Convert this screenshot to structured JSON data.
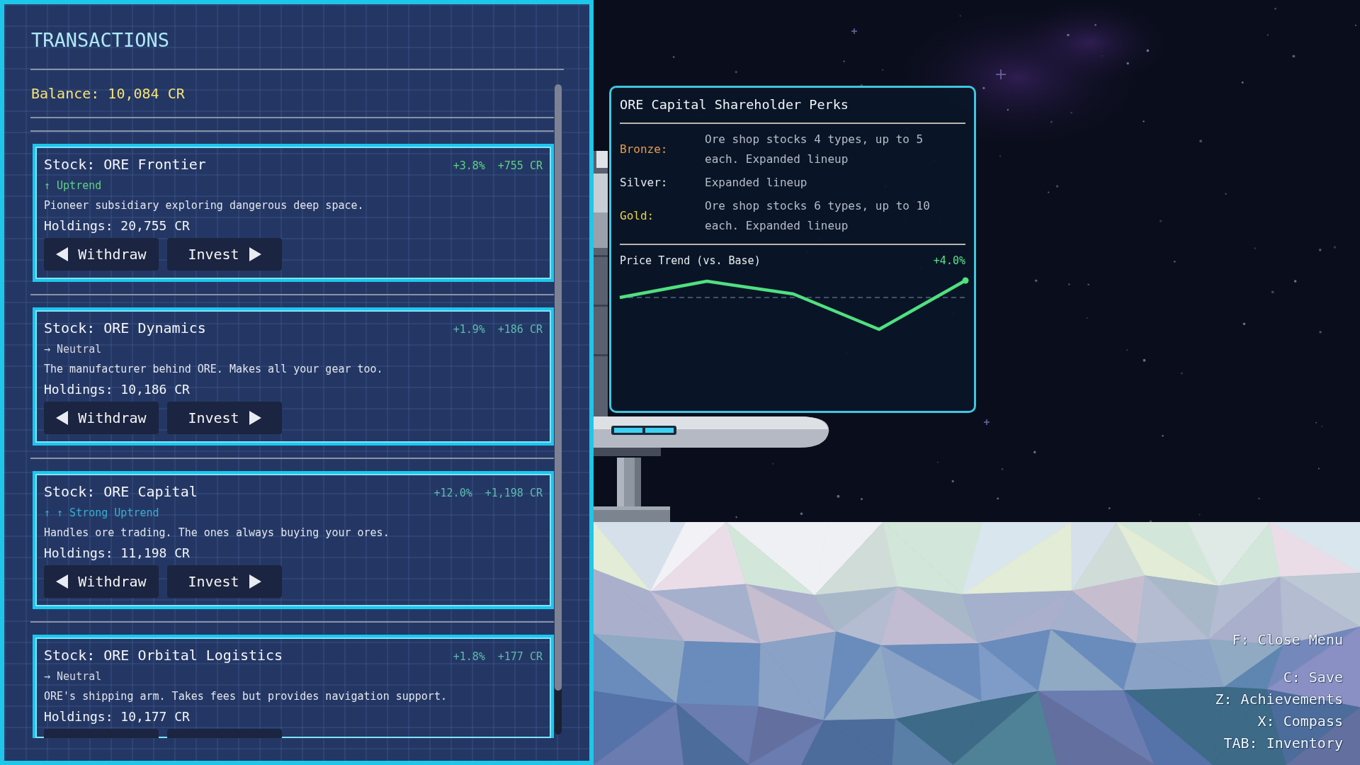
{
  "panel": {
    "title": "TRANSACTIONS",
    "balance": "Balance: 10,084 CR"
  },
  "stocks": [
    {
      "name": "Stock: ORE Frontier",
      "change": {
        "percent": "+3.8%",
        "amount": "+755 CR",
        "color": "#5cd483"
      },
      "trend": {
        "text": "↑ Uptrend",
        "color": "#5cd483"
      },
      "description": "Pioneer subsidiary exploring dangerous deep space.",
      "holdings": "Holdings: 20,755 CR",
      "buttons": [
        {
          "kind": "withdraw",
          "label": "Withdraw"
        },
        {
          "kind": "invest",
          "label": "Invest"
        }
      ]
    },
    {
      "name": "Stock: ORE Dynamics",
      "change": {
        "percent": "+1.9%",
        "amount": "+186 CR",
        "color": "#5cbcb0"
      },
      "trend": {
        "text": "→ Neutral",
        "color": "#d4d8e0"
      },
      "description": "The manufacturer behind ORE. Makes all your gear too.",
      "holdings": "Holdings: 10,186 CR",
      "buttons": [
        {
          "kind": "withdraw",
          "label": "Withdraw"
        },
        {
          "kind": "invest",
          "label": "Invest"
        }
      ]
    },
    {
      "name": "Stock: ORE Capital",
      "change": {
        "percent": "+12.0%",
        "amount": "+1,198 CR",
        "color": "#5cbcb0"
      },
      "trend": {
        "text": "↑ ↑ Strong Uptrend",
        "color": "#3aaed0"
      },
      "description": "Handles ore trading. The ones always buying your ores.",
      "holdings": "Holdings: 11,198 CR",
      "buttons": [
        {
          "kind": "withdraw",
          "label": "Withdraw"
        },
        {
          "kind": "invest",
          "label": "Invest"
        }
      ]
    },
    {
      "name": "Stock: ORE Orbital Logistics",
      "change": {
        "percent": "+1.8%",
        "amount": "+177 CR",
        "color": "#5cbcb0"
      },
      "trend": {
        "text": "→ Neutral",
        "color": "#d4d8e0"
      },
      "description": "ORE's shipping arm. Takes fees but provides navigation support.",
      "holdings": "Holdings: 10,177 CR",
      "buttons": [
        {
          "kind": "withdraw"
        },
        {
          "kind": "invest"
        }
      ]
    }
  ],
  "perks_tooltip": {
    "title": "ORE Capital Shareholder Perks",
    "tiers": [
      {
        "label": "Bronze:",
        "text": "Ore shop stocks 4 types, up to 5 each. Expanded lineup",
        "color": "#e89b4a"
      },
      {
        "label": "Silver:",
        "text": "Expanded lineup",
        "color": "#e4e6ea"
      },
      {
        "label": "Gold:",
        "text": "Ore shop stocks 6 types, up to 10 each. Expanded lineup",
        "color": "#f2d13e"
      }
    ],
    "trend_label": "Price Trend (vs. Base)",
    "trend_change": "+4.0%"
  },
  "key_hints": {
    "menu": "F: Close Menu",
    "shortcuts": [
      "C: Save",
      "Z: Achievements",
      "X: Compass",
      "TAB: Inventory"
    ]
  }
}
